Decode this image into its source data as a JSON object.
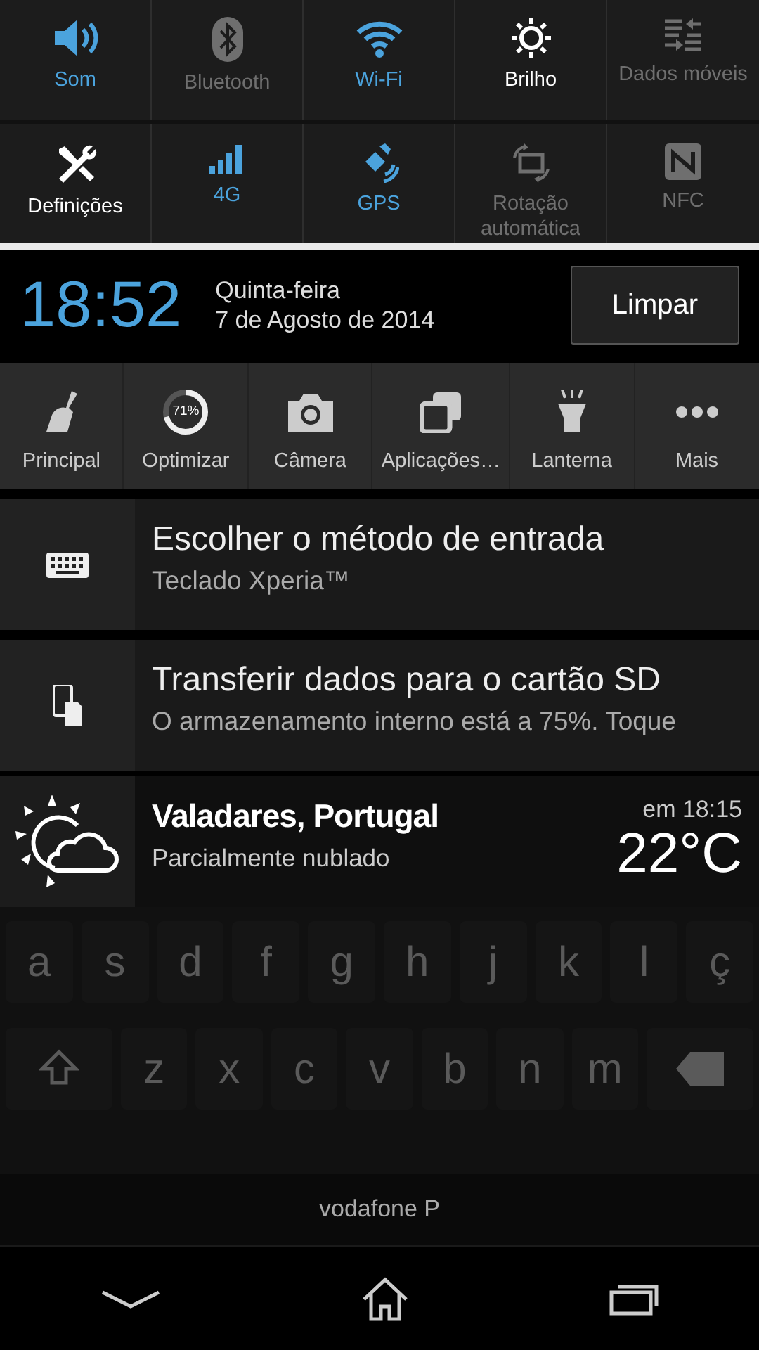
{
  "quick_settings": [
    {
      "label": "Som",
      "kind": "toggle",
      "on": true
    },
    {
      "label": "Bluetooth",
      "kind": "toggle",
      "on": false
    },
    {
      "label": "Wi-Fi",
      "kind": "toggle",
      "on": true
    },
    {
      "label": "Brilho",
      "kind": "action"
    },
    {
      "label": "Dados móveis",
      "kind": "toggle",
      "on": false
    },
    {
      "label": "Definições",
      "kind": "action"
    },
    {
      "label": "4G",
      "kind": "toggle",
      "on": true
    },
    {
      "label": "GPS",
      "kind": "toggle",
      "on": true
    },
    {
      "label": "Rotação automática",
      "kind": "toggle",
      "on": false
    },
    {
      "label": "NFC",
      "kind": "toggle",
      "on": false
    }
  ],
  "clock": {
    "time": "18:52",
    "weekday": "Quinta-feira",
    "date": "7 de Agosto de 2014",
    "clear_button": "Limpar"
  },
  "shortcuts": [
    {
      "label": "Principal"
    },
    {
      "label": "Optimizar",
      "badge": "71%",
      "level": 0.71
    },
    {
      "label": "Câmera"
    },
    {
      "label": "Aplicações…"
    },
    {
      "label": "Lanterna"
    },
    {
      "label": "Mais"
    }
  ],
  "notifications": [
    {
      "title": "Escolher o método de entrada",
      "text": "Teclado Xperia™"
    },
    {
      "title": "Transferir dados para o cartão SD",
      "text": "O armazenamento interno está a 75%. Toque"
    }
  ],
  "weather": {
    "location": "Valadares, Portugal",
    "condition": "Parcialmente nublado",
    "updated": "em 18:15",
    "temperature": "22°C"
  },
  "keyboard": {
    "rows": [
      [
        "a",
        "s",
        "d",
        "f",
        "g",
        "h",
        "j",
        "k",
        "l",
        "ç"
      ],
      [
        "z",
        "x",
        "c",
        "v",
        "b",
        "n",
        "m"
      ]
    ]
  },
  "carrier": "vodafone P"
}
